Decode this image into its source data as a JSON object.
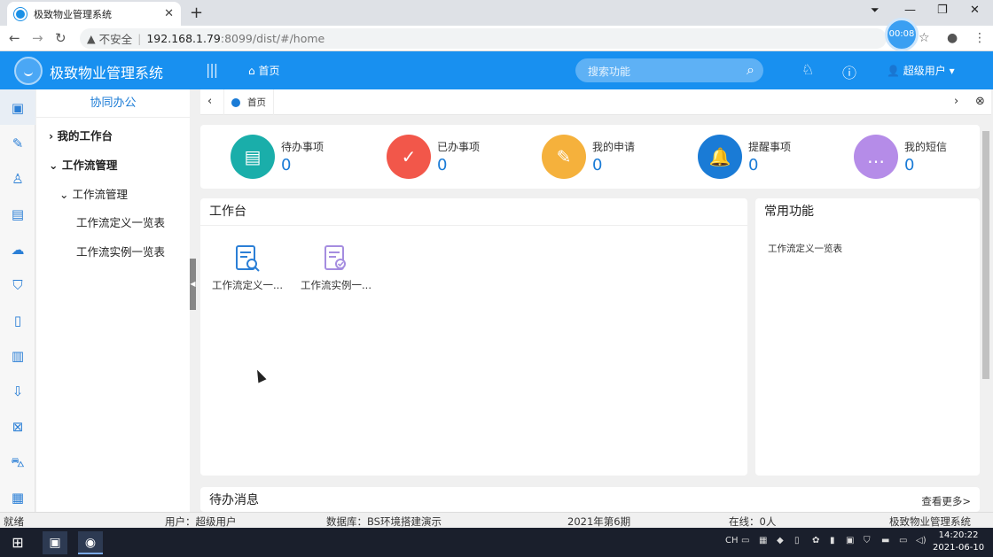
{
  "browser": {
    "tab_title": "极致物业管理系统",
    "url_warning": "不安全",
    "url_host": "192.168.1.79",
    "url_path": ":8099/dist/#/home",
    "recording_time": "00:08"
  },
  "header": {
    "app_title": "极致物业管理系统",
    "home_label": "首页",
    "search_placeholder": "搜索功能",
    "user_label": "超级用户"
  },
  "tree": {
    "section_title": "协同办公",
    "items": [
      {
        "label": "我的工作台"
      },
      {
        "label": "工作流管理"
      },
      {
        "label": "工作流管理"
      },
      {
        "label": "工作流定义一览表"
      },
      {
        "label": "工作流实例一览表"
      }
    ]
  },
  "breadcrumb": {
    "current": "首页"
  },
  "stats": [
    {
      "label": "待办事项",
      "count": "0",
      "color": "#1aaeaa"
    },
    {
      "label": "已办事项",
      "count": "0",
      "color": "#f2574a"
    },
    {
      "label": "我的申请",
      "count": "0",
      "color": "#f5b13c"
    },
    {
      "label": "提醒事项",
      "count": "0",
      "color": "#1a7bd6"
    },
    {
      "label": "我的短信",
      "count": "0",
      "color": "#b58ce8"
    }
  ],
  "workbench": {
    "title": "工作台",
    "shortcuts": [
      {
        "label": "工作流定义一..."
      },
      {
        "label": "工作流实例一..."
      }
    ]
  },
  "common": {
    "title": "常用功能",
    "items": [
      {
        "label": "工作流定义一览表"
      }
    ]
  },
  "pending": {
    "title": "待办消息",
    "more": "查看更多>"
  },
  "statusbar": {
    "state": "就绪",
    "user": "用户：超级用户",
    "database": "数据库：BS环境搭建演示",
    "period": "2021年第6期",
    "online": "在线：0人",
    "system": "极致物业管理系统"
  },
  "taskbar": {
    "ime": "CH",
    "time": "14:20:22",
    "date": "2021-06-10"
  }
}
